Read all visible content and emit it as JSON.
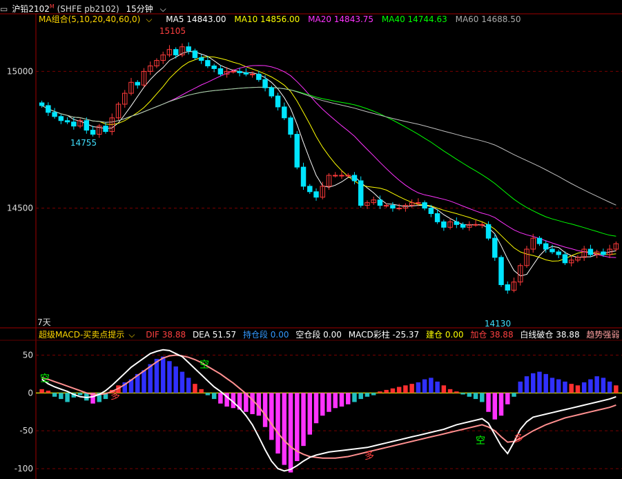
{
  "header": {
    "icon": "window-toggle-icon",
    "symbol": "沪铅2102",
    "symbol_marker": "M",
    "code": "(SHFE pb2102)",
    "period": "15分钟",
    "period_dropdown_icon": "chevron-down-icon"
  },
  "ma_legend": {
    "group": "MA组合(5,10,20,40,60,0)",
    "group_icon": "chevron-down-icon",
    "ma5": "MA5 14843.00",
    "ma10": "MA10 14856.00",
    "ma20": "MA20 14843.75",
    "ma40": "MA40 14744.63",
    "ma60": "MA60 14688.50",
    "colors": {
      "ma5": "#ffffff",
      "ma10": "#ffff00",
      "ma20": "#ff33ff",
      "ma40": "#00ff00",
      "ma60": "#c0c0c0"
    }
  },
  "price_axis": {
    "labels": [
      "15000",
      "14500"
    ]
  },
  "annotations": {
    "high": "15105",
    "low_left": "14755",
    "low_right": "14130",
    "days": "7天"
  },
  "macd_legend": {
    "indicator": "超级MACD-买卖点提示",
    "dif": "DIF 38.88",
    "dea": "DEA 51.57",
    "hold": "持仓段 0.00",
    "empty": "空仓段 0.00",
    "bar": "MACD彩柱 -25.37",
    "build": "建仓 0.00",
    "add": "加仓 38.88",
    "break": "白线破仓 38.88",
    "trend": "趋势强弱 51.57"
  },
  "macd_axis": {
    "labels": [
      "50",
      "0",
      "-50",
      "-100"
    ]
  },
  "signals": {
    "kong": "空",
    "duo": "多"
  },
  "chart_data": [
    {
      "type": "candlestick",
      "ylim": [
        14080,
        15160
      ],
      "closes": [
        14875,
        14850,
        14835,
        14820,
        14815,
        14800,
        14820,
        14785,
        14770,
        14800,
        14780,
        14830,
        14880,
        14920,
        14960,
        14950,
        15000,
        15020,
        15040,
        15060,
        15080,
        15060,
        15090,
        15075,
        15050,
        15040,
        15020,
        15010,
        14990,
        15000,
        15000,
        14995,
        14990,
        14990,
        14970,
        14940,
        14910,
        14870,
        14830,
        14770,
        14650,
        14580,
        14560,
        14540,
        14580,
        14620,
        14620,
        14620,
        14620,
        14600,
        14510,
        14520,
        14530,
        14510,
        14510,
        14500,
        14500,
        14510,
        14520,
        14520,
        14500,
        14480,
        14450,
        14430,
        14450,
        14440,
        14430,
        14440,
        14440,
        14440,
        14390,
        14320,
        14220,
        14200,
        14230,
        14290,
        14350,
        14390,
        14370,
        14350,
        14340,
        14330,
        14300,
        14310,
        14320,
        14350,
        14330,
        14340,
        14330,
        14350,
        14370
      ]
    },
    {
      "type": "macd",
      "ylim": [
        -110,
        65
      ],
      "hist": [
        5,
        3,
        -5,
        -8,
        -12,
        -6,
        -3,
        -10,
        -14,
        -12,
        -8,
        4,
        10,
        14,
        18,
        25,
        30,
        38,
        45,
        48,
        42,
        35,
        28,
        20,
        12,
        5,
        -3,
        -8,
        -14,
        -18,
        -20,
        -22,
        -25,
        -28,
        -30,
        -45,
        -62,
        -80,
        -95,
        -105,
        -90,
        -70,
        -55,
        -40,
        -30,
        -25,
        -20,
        -18,
        -15,
        -12,
        -8,
        -5,
        -3,
        2,
        4,
        6,
        8,
        10,
        12,
        14,
        18,
        20,
        15,
        10,
        5,
        2,
        -2,
        -5,
        -8,
        -12,
        -25,
        -35,
        -30,
        -15,
        -5,
        15,
        22,
        26,
        28,
        25,
        20,
        18,
        15,
        12,
        10,
        14,
        18,
        22,
        20,
        15,
        10
      ],
      "dif": [
        18,
        12,
        8,
        5,
        2,
        -2,
        -5,
        -6,
        -5,
        -2,
        3,
        10,
        18,
        26,
        34,
        40,
        46,
        52,
        55,
        57,
        56,
        52,
        48,
        40,
        32,
        24,
        16,
        8,
        2,
        -5,
        -12,
        -20,
        -30,
        -42,
        -58,
        -75,
        -90,
        -100,
        -103,
        -101,
        -96,
        -90,
        -85,
        -82,
        -80,
        -78,
        -77,
        -76,
        -75,
        -74,
        -73,
        -72,
        -70,
        -68,
        -66,
        -64,
        -62,
        -60,
        -58,
        -56,
        -54,
        -52,
        -50,
        -48,
        -45,
        -42,
        -40,
        -38,
        -36,
        -34,
        -40,
        -55,
        -70,
        -80,
        -65,
        -48,
        -38,
        -32,
        -30,
        -28,
        -26,
        -24,
        -22,
        -20,
        -18,
        -16,
        -14,
        -12,
        -10,
        -8,
        -5
      ],
      "dea": [
        20,
        18,
        15,
        12,
        9,
        6,
        3,
        0,
        -2,
        -2,
        -1,
        2,
        6,
        11,
        17,
        23,
        29,
        35,
        41,
        46,
        49,
        50,
        49,
        47,
        44,
        40,
        35,
        30,
        25,
        19,
        13,
        6,
        -1,
        -9,
        -18,
        -29,
        -41,
        -53,
        -63,
        -71,
        -77,
        -81,
        -84,
        -85,
        -86,
        -86,
        -86,
        -85,
        -84,
        -82,
        -80,
        -78,
        -76,
        -74,
        -72,
        -70,
        -68,
        -66,
        -64,
        -62,
        -60,
        -58,
        -56,
        -54,
        -52,
        -50,
        -48,
        -46,
        -44,
        -42,
        -45,
        -50,
        -58,
        -65,
        -64,
        -60,
        -55,
        -50,
        -46,
        -42,
        -39,
        -36,
        -33,
        -31,
        -29,
        -27,
        -25,
        -23,
        -21,
        -19,
        -16
      ]
    }
  ]
}
